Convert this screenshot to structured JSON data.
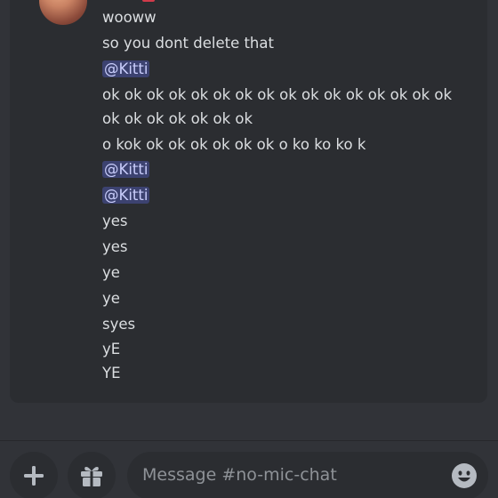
{
  "messages": [
    {
      "type": "text",
      "text": "wooww"
    },
    {
      "type": "text",
      "text": "so you dont delete that"
    },
    {
      "type": "mention",
      "text": "@Kitti"
    },
    {
      "type": "text",
      "text": "ok ok ok ok ok ok ok ok ok ok ok ok ok ok ok ok"
    },
    {
      "type": "text",
      "text": "ok ok ok ok ok ok ok"
    },
    {
      "type": "text",
      "text": "o kok ok ok ok ok ok ok o ko ko ko k"
    },
    {
      "type": "mention",
      "text": "@Kitti"
    },
    {
      "type": "mention",
      "text": "@Kitti"
    },
    {
      "type": "text",
      "text": "yes"
    },
    {
      "type": "text",
      "text": "yes"
    },
    {
      "type": "text",
      "text": "ye"
    },
    {
      "type": "text",
      "text": "ye"
    },
    {
      "type": "text",
      "text": "syes"
    },
    {
      "type": "text",
      "text": "yE"
    },
    {
      "type": "text",
      "text": "YE"
    }
  ],
  "composer": {
    "placeholder": "Message #no-mic-chat"
  },
  "icons": {
    "add": "plus-icon",
    "gift": "gift-icon",
    "emoji": "smiley-icon"
  },
  "colors": {
    "background": "#313338",
    "card": "#2b2d31",
    "text": "#dbdee1",
    "mention_bg": "#3c4270",
    "mention_text": "#c9cdfb",
    "placeholder": "#8e9297"
  }
}
